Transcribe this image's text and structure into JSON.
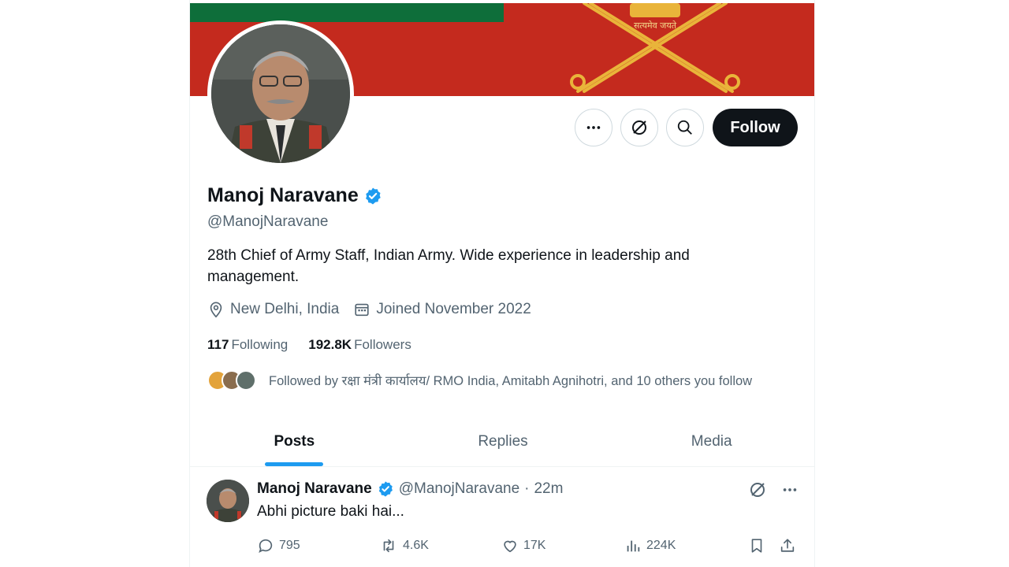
{
  "colors": {
    "accent": "#1d9bf0",
    "text": "#0f1419",
    "muted": "#536471",
    "banner_red": "#c42a1e",
    "banner_green": "#0e6e3a"
  },
  "banner": {
    "motto": "सत्यमेव जयते"
  },
  "actions": {
    "more_icon": "more-horizontal-icon",
    "grok_icon": "grok-icon",
    "search_icon": "search-icon",
    "follow_label": "Follow"
  },
  "profile": {
    "name": "Manoj Naravane",
    "handle": "@ManojNaravane",
    "bio": "28th Chief of Army Staff, Indian Army. Wide experience in leadership and management.",
    "location": "New Delhi, India",
    "joined": "Joined November 2022",
    "following_count": "117",
    "following_label": "Following",
    "followers_count": "192.8K",
    "followers_label": "Followers",
    "followed_by": "Followed by रक्षा मंत्री कार्यालय/ RMO India, Amitabh Agnihotri, and 10 others you follow"
  },
  "tabs": [
    {
      "label": "Posts"
    },
    {
      "label": "Replies"
    },
    {
      "label": "Media"
    }
  ],
  "tweet": {
    "name": "Manoj Naravane",
    "handle": "@ManojNaravane",
    "dot": "·",
    "time": "22m",
    "text": "Abhi picture baki hai...",
    "replies": "795",
    "reposts": "4.6K",
    "likes": "17K",
    "views": "224K"
  }
}
